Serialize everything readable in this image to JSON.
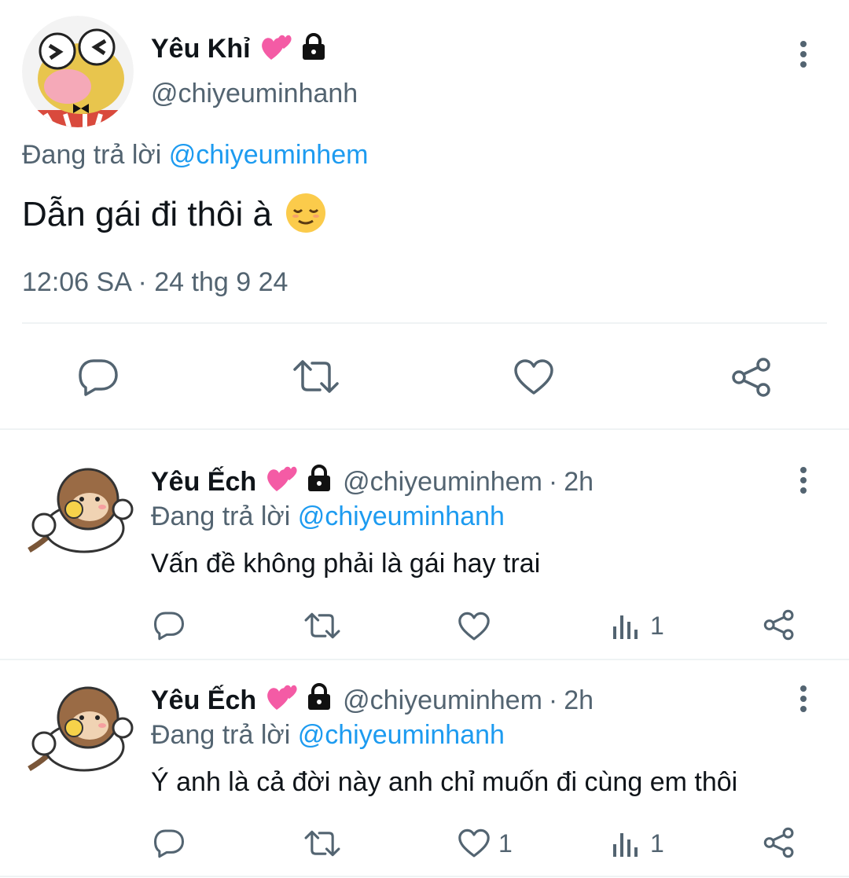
{
  "main_tweet": {
    "display_name": "Yêu Khỉ",
    "handle": "@chiyeuminhanh",
    "replying_prefix": "Đang trả lời",
    "replying_to": "@chiyeuminhem",
    "text": "Dẫn gái đi thôi à",
    "time": "12:06 SA",
    "sep": "·",
    "date": "24 thg 9 24",
    "icons": [
      "reply-icon",
      "retweet-icon",
      "like-icon",
      "share-icon"
    ]
  },
  "replies": [
    {
      "display_name": "Yêu Ếch",
      "handle": "@chiyeuminhem",
      "sep": "·",
      "time": "2h",
      "replying_prefix": "Đang trả lời",
      "replying_to": "@chiyeuminhanh",
      "text": "Vấn đề không phải là gái hay trai",
      "like_count": "",
      "views_count": "1"
    },
    {
      "display_name": "Yêu Ếch",
      "handle": "@chiyeuminhem",
      "sep": "·",
      "time": "2h",
      "replying_prefix": "Đang trả lời",
      "replying_to": "@chiyeuminhanh",
      "text": "Ý anh là cả đời này anh chỉ muốn đi cùng em thôi",
      "like_count": "1",
      "views_count": "1"
    }
  ],
  "colors": {
    "gray": "#536471",
    "blue": "#1d9bf0",
    "heart": "#f45ba5",
    "text": "#0f1419"
  }
}
